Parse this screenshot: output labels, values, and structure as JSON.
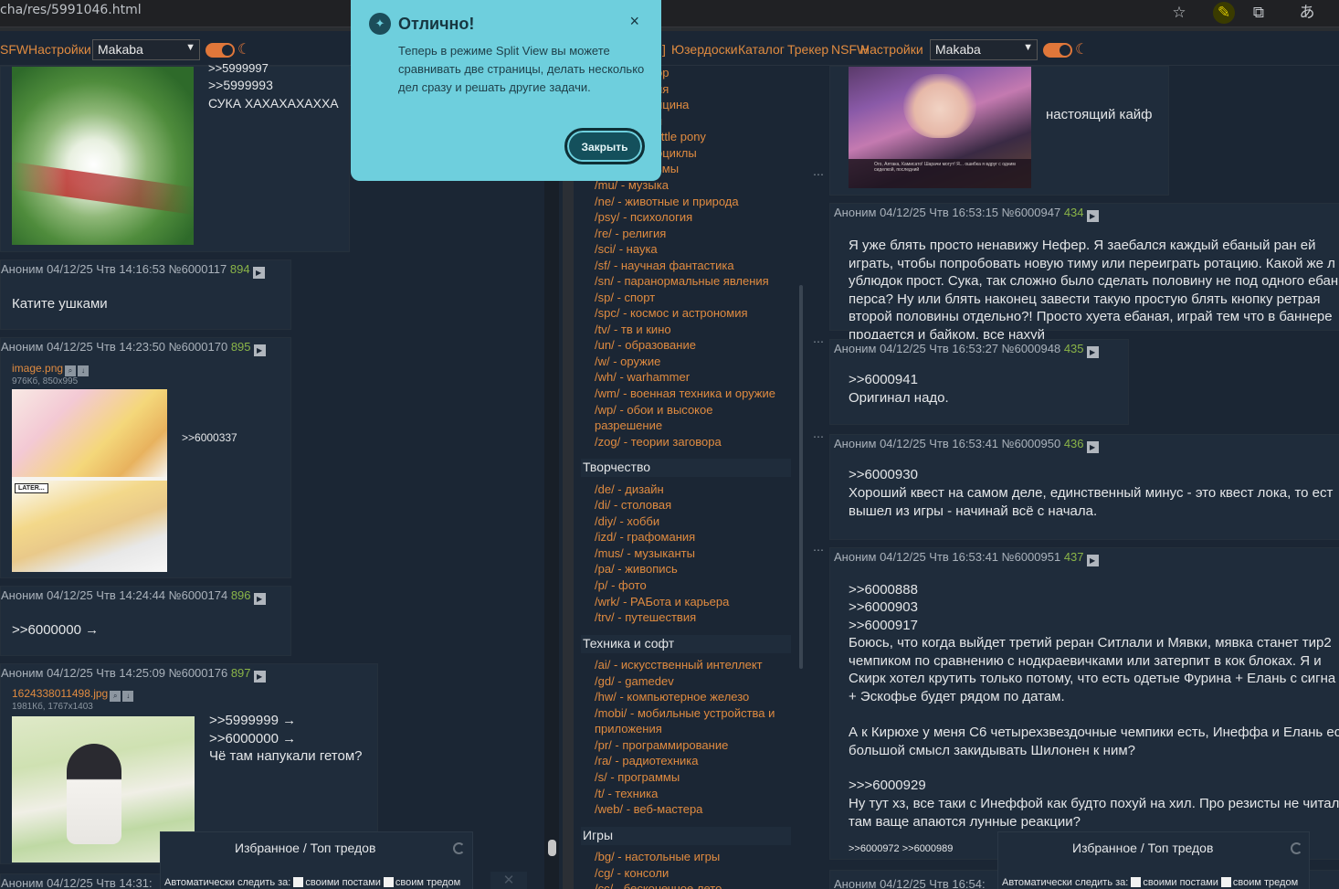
{
  "browser": {
    "url": "cha/res/5991046.html",
    "icons": [
      "star-icon",
      "extension-icon",
      "puzzle-icon",
      "translate-icon"
    ]
  },
  "left_nav": {
    "links": [
      "SFW",
      "Настройки"
    ],
    "style_select": "Makaba"
  },
  "right_nav": {
    "links_prefix": "]",
    "links": [
      "Юзердоски",
      "Каталог",
      "Трекер",
      "NSFW",
      "Настройки"
    ],
    "style_select": "Makaba"
  },
  "popup": {
    "title": "Отлично!",
    "body": "Теперь в режиме Split View вы можете сравнивать две страницы, делать несколько дел сразу и решать другие задачи.",
    "button": "Закрыть",
    "close": "×"
  },
  "left_posts": [
    {
      "reply": ">>5999993",
      "reply_cut": ">>5999997",
      "text": "СУКА ХАХАХАХАХХА"
    },
    {
      "header": "Аноним 04/12/25 Чтв 14:16:53 №6000117",
      "num": "894",
      "text": "Катите ушками"
    },
    {
      "header": "Аноним 04/12/25 Чтв 14:23:50 №6000170",
      "num": "895",
      "file": "image.png",
      "fsize": "976Кб, 850x995",
      "reply": ">>6000337"
    },
    {
      "header": "Аноним 04/12/25 Чтв 14:24:44 №6000174",
      "num": "896",
      "reply": ">>6000000 →"
    },
    {
      "header": "Аноним 04/12/25 Чтв 14:25:09 №6000176",
      "num": "897",
      "file": "1624338011498.jpg",
      "fsize": "1981Кб, 1767x1403",
      "replies": [
        ">>5999999 →",
        ">>6000000 →"
      ],
      "text": "Чё там напукали гетом?"
    },
    {
      "header": "Аноним 04/12/25 Чтв 14:31:"
    }
  ],
  "comic_label": "LATER...",
  "boards": {
    "top_cut": [
      "ор",
      "ия",
      "ицина",
      "я",
      "little pony",
      "оциклы",
      "ьмы"
    ],
    "group1": [
      {
        "code": "/mu/",
        "name": " - музыка"
      },
      {
        "code": "/ne/",
        "name": " - животные и природа"
      },
      {
        "code": "/psy/",
        "name": " - психология"
      },
      {
        "code": "/re/",
        "name": " - религия"
      },
      {
        "code": "/sci/",
        "name": " - наука"
      },
      {
        "code": "/sf/",
        "name": " - научная фантастика"
      },
      {
        "code": "/sn/",
        "name": " - паранормальные явления"
      },
      {
        "code": "/sp/",
        "name": " - спорт"
      },
      {
        "code": "/spc/",
        "name": " - космос и астрономия"
      },
      {
        "code": "/tv/",
        "name": " - тв и кино"
      },
      {
        "code": "/un/",
        "name": " - образование"
      },
      {
        "code": "/w/",
        "name": " - оружие"
      },
      {
        "code": "/wh/",
        "name": " - warhammer"
      },
      {
        "code": "/wm/",
        "name": " - военная техника и оружие"
      },
      {
        "code": "/wp/",
        "name": " - обои и высокое"
      },
      {
        "code": "",
        "name": "разрешение"
      },
      {
        "code": "/zog/",
        "name": " - теории заговора"
      }
    ],
    "heading2": "Творчество",
    "group2": [
      {
        "code": "/de/",
        "name": " - дизайн"
      },
      {
        "code": "/di/",
        "name": " - столовая"
      },
      {
        "code": "/diy/",
        "name": " - хобби"
      },
      {
        "code": "/izd/",
        "name": " - графомания"
      },
      {
        "code": "/mus/",
        "name": " - музыканты"
      },
      {
        "code": "/pa/",
        "name": " - живопись"
      },
      {
        "code": "/p/",
        "name": " - фото"
      },
      {
        "code": "/wrk/",
        "name": " - РАБота и карьера"
      },
      {
        "code": "/trv/",
        "name": " - путешествия"
      }
    ],
    "heading3": "Техника и софт",
    "group3": [
      {
        "code": "/ai/",
        "name": " - искусственный интеллект"
      },
      {
        "code": "/gd/",
        "name": " - gamedev"
      },
      {
        "code": "/hw/",
        "name": " - компьютерное железо"
      },
      {
        "code": "/mobi/",
        "name": " - мобильные устройства и"
      },
      {
        "code": "",
        "name": "приложения"
      },
      {
        "code": "/pr/",
        "name": " - программирование"
      },
      {
        "code": "/ra/",
        "name": " - радиотехника"
      },
      {
        "code": "/s/",
        "name": " - программы"
      },
      {
        "code": "/t/",
        "name": " - техника"
      },
      {
        "code": "/web/",
        "name": " - веб-мастера"
      }
    ],
    "heading4": "Игры",
    "group4": [
      {
        "code": "/bg/",
        "name": " - настольные игры"
      },
      {
        "code": "/cg/",
        "name": " - консоли"
      },
      {
        "code": "/cc/",
        "name": " - бесконечное лето"
      }
    ]
  },
  "right_posts": [
    {
      "text": "настоящий кайф",
      "caption": "Ого, Аятака, Камисато! Шарачи могут! Я... ошибка я вдруг с одним сиделкой, последний"
    },
    {
      "header": "Аноним 04/12/25 Чтв 16:53:15 №6000947",
      "num": "434",
      "text": "Я уже блять просто ненавижу Нефер. Я заебался каждый ебаный ран ей играть, чтобы попробовать новую тиму или переиграть ротацию. Какой же л ублюдок прост. Сука, так сложно было сделать половину не под одного ебан перса? Ну или блять наконец завести такую простую блять кнопку ретрая второй половины отдельно?! Просто хуета ебаная, играй тем что в баннере продается и байком, все нахуй"
    },
    {
      "header": "Аноним 04/12/25 Чтв 16:53:27 №6000948",
      "num": "435",
      "reply": ">>6000941",
      "text": "Оригинал надо."
    },
    {
      "header": "Аноним 04/12/25 Чтв 16:53:41 №6000950",
      "num": "436",
      "reply": ">>6000930",
      "text": "Хороший квест на самом деле, единственный минус - это квест лока, то ест вышел из игры - начинай всё с начала."
    },
    {
      "header": "Аноним 04/12/25 Чтв 16:53:41 №6000951",
      "num": "437",
      "replies": [
        ">>6000888",
        ">>6000903",
        ">>6000917"
      ],
      "text1": "Боюсь, что когда выйдет третий реран Ситлали и Мявки, мявка станет тир2 чемпиком по сравнению с нодкраевичками или затерпит в кок блоках. Я и Скирк хотел крутить только потому, что есть одетые Фурина + Елань с сигна + Эскофье будет рядом по датам.",
      "text2": "А к Кирюхе у меня С6 четырехзвездочные чемпики есть, Инеффа и Елань ес большой смысл закидывать Шилонен к ним?",
      "reply2": ">>>6000929",
      "text3": "Ну тут хз, все таки с Инеффой как будто похуй на хил. Про резисты не читал там ваще апаются лунные реакции?",
      "backrefs": ">>6000972 >>6000989"
    },
    {
      "header": "Аноним 04/12/25 Чтв 16:54:"
    }
  ],
  "favorites": {
    "title": "Избранное / Топ тредов",
    "auto_label": "Автоматически следить за:",
    "opt1": "своими постами",
    "opt2": "своим тредом"
  },
  "colors": {
    "accent": "#e08b40",
    "bg": "#1b2634",
    "post_bg": "#1f2c3b",
    "popup": "#6ecfdd",
    "reply_num": "#8ab448"
  }
}
